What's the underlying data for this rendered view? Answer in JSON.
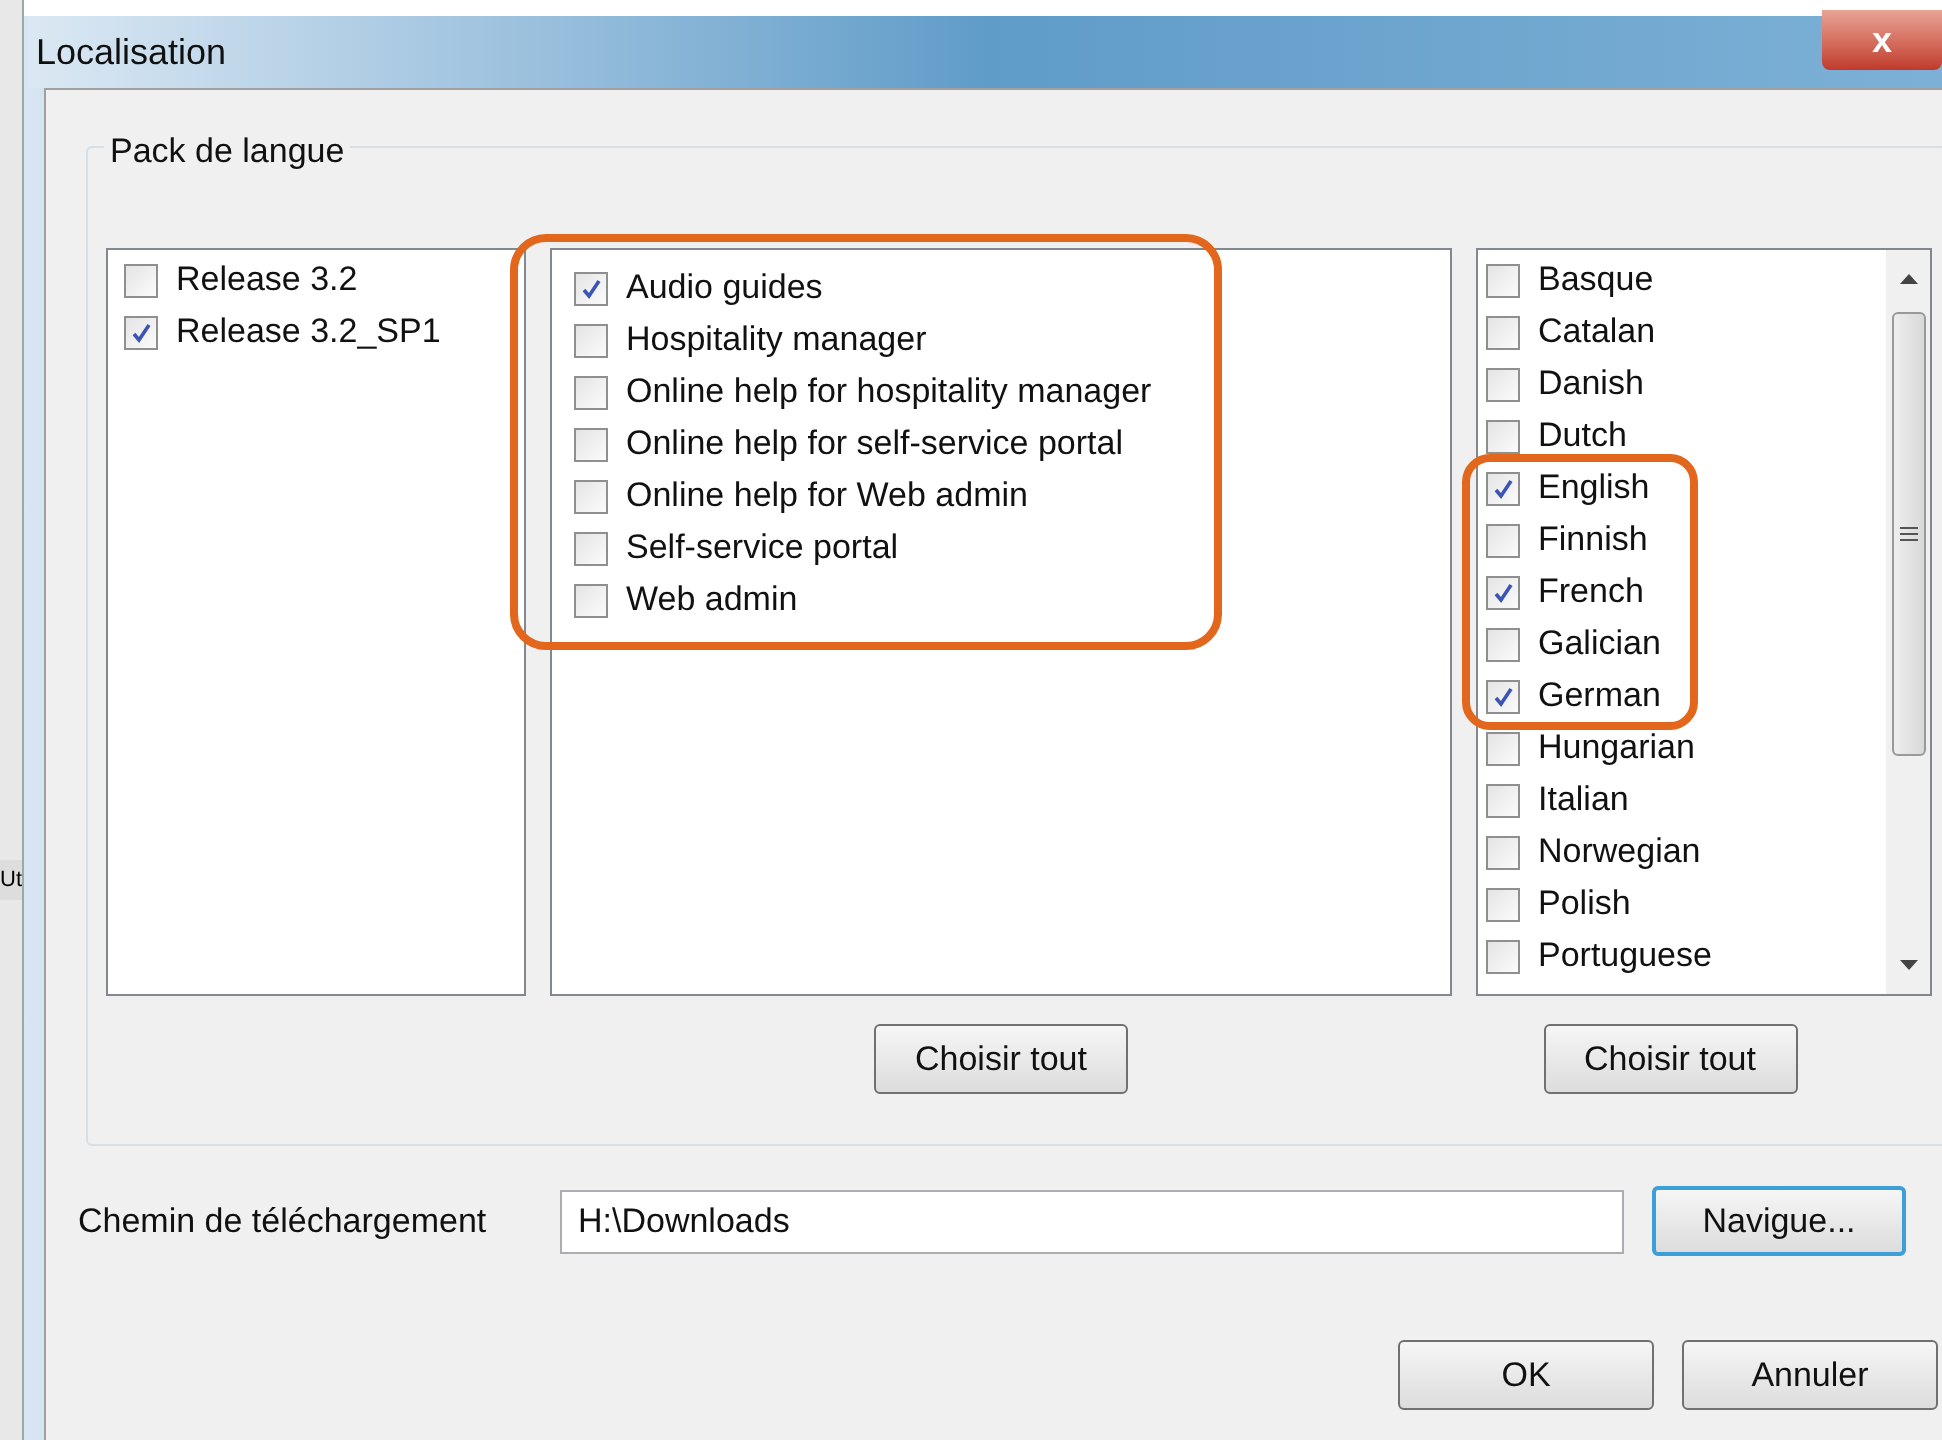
{
  "background_window": {
    "text": "Ut"
  },
  "window": {
    "title": "Localisation",
    "close": "x"
  },
  "group": {
    "title": "Pack de langue"
  },
  "releases": [
    {
      "label": "Release 3.2",
      "checked": false
    },
    {
      "label": "Release 3.2_SP1",
      "checked": true
    }
  ],
  "components": {
    "highlighted": true,
    "items": [
      {
        "label": "Audio guides",
        "checked": true
      },
      {
        "label": "Hospitality manager",
        "checked": false
      },
      {
        "label": "Online help for hospitality manager",
        "checked": false
      },
      {
        "label": "Online help for self-service portal",
        "checked": false
      },
      {
        "label": "Online help for Web admin",
        "checked": false
      },
      {
        "label": "Self-service portal",
        "checked": false
      },
      {
        "label": "Web admin",
        "checked": false
      }
    ],
    "button": "Choisir tout"
  },
  "languages": {
    "items": [
      {
        "label": "Basque",
        "checked": false,
        "highlighted": false
      },
      {
        "label": "Catalan",
        "checked": false,
        "highlighted": false
      },
      {
        "label": "Danish",
        "checked": false,
        "highlighted": false
      },
      {
        "label": "Dutch",
        "checked": false,
        "highlighted": false
      },
      {
        "label": "English",
        "checked": true,
        "highlighted": true
      },
      {
        "label": "Finnish",
        "checked": false,
        "highlighted": true
      },
      {
        "label": "French",
        "checked": true,
        "highlighted": true
      },
      {
        "label": "Galician",
        "checked": false,
        "highlighted": true
      },
      {
        "label": "German",
        "checked": true,
        "highlighted": true
      },
      {
        "label": "Hungarian",
        "checked": false,
        "highlighted": false
      },
      {
        "label": "Italian",
        "checked": false,
        "highlighted": false
      },
      {
        "label": "Norwegian",
        "checked": false,
        "highlighted": false
      },
      {
        "label": "Polish",
        "checked": false,
        "highlighted": false
      },
      {
        "label": "Portuguese",
        "checked": false,
        "highlighted": false
      }
    ],
    "button": "Choisir tout"
  },
  "download": {
    "label": "Chemin de téléchargement",
    "value": "H:\\Downloads",
    "button": "Navigue..."
  },
  "buttons": [
    "OK",
    "Annuler"
  ]
}
